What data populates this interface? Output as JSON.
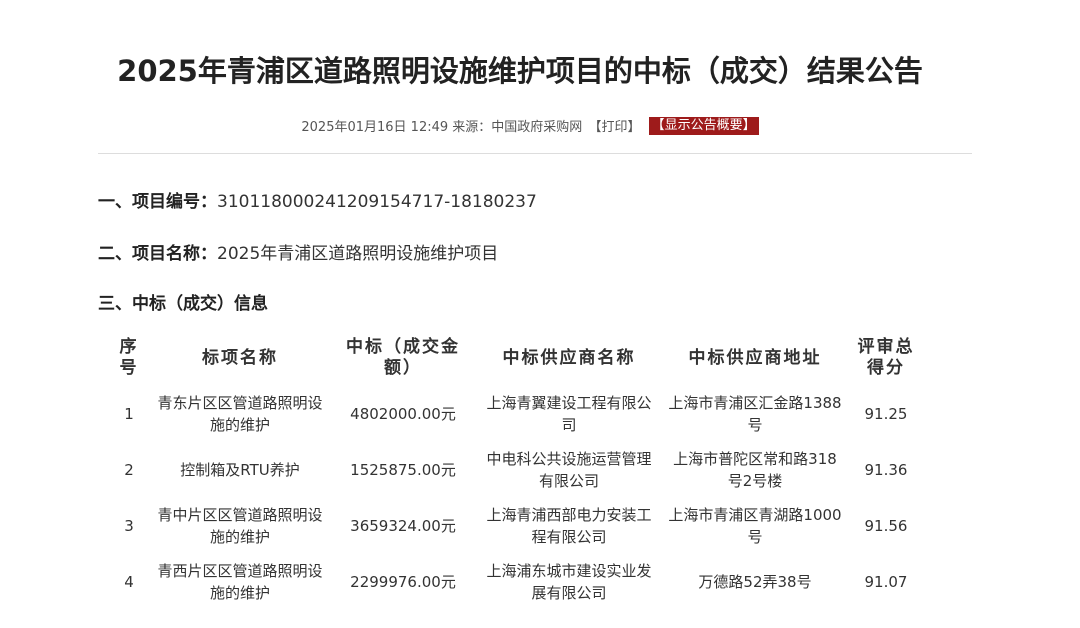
{
  "title": "2025年青浦区道路照明设施维护项目的中标（成交）结果公告",
  "meta": {
    "datetime": "2025年01月16日 12:49",
    "source_label": "来源：",
    "source": "中国政府采购网",
    "print": "【打印】",
    "summary_button": "【显示公告概要】"
  },
  "sections": {
    "project_no": {
      "heading": "一、项目编号：",
      "value": "310118000241209154717-18180237"
    },
    "project_name": {
      "heading": "二、项目名称：",
      "value": "2025年青浦区道路照明设施维护项目"
    },
    "award_info": {
      "heading": "三、中标（成交）信息"
    }
  },
  "table": {
    "headers": {
      "seq": "序号",
      "lot_name": "标项名称",
      "amount": "中标（成交金额）",
      "supplier": "中标供应商名称",
      "address": "中标供应商地址",
      "score": "评审总得分"
    },
    "rows": [
      {
        "seq": "1",
        "lot_name": "青东片区区管道路照明设施的维护",
        "amount": "4802000.00元",
        "supplier": "上海青翼建设工程有限公司",
        "address": "上海市青浦区汇金路1388号",
        "score": "91.25"
      },
      {
        "seq": "2",
        "lot_name": "控制箱及RTU养护",
        "amount": "1525875.00元",
        "supplier": "中电科公共设施运营管理有限公司",
        "address": "上海市普陀区常和路318号2号楼",
        "score": "91.36"
      },
      {
        "seq": "3",
        "lot_name": "青中片区区管道路照明设施的维护",
        "amount": "3659324.00元",
        "supplier": "上海青浦西部电力安装工程有限公司",
        "address": "上海市青浦区青湖路1000号",
        "score": "91.56"
      },
      {
        "seq": "4",
        "lot_name": "青西片区区管道路照明设施的维护",
        "amount": "2299976.00元",
        "supplier": "上海浦东城市建设实业发展有限公司",
        "address": "万德路52弄38号",
        "score": "91.07"
      }
    ]
  },
  "colors": {
    "summary_button_bg": "#9e1b1b",
    "text": "#333333",
    "title": "#222222"
  }
}
